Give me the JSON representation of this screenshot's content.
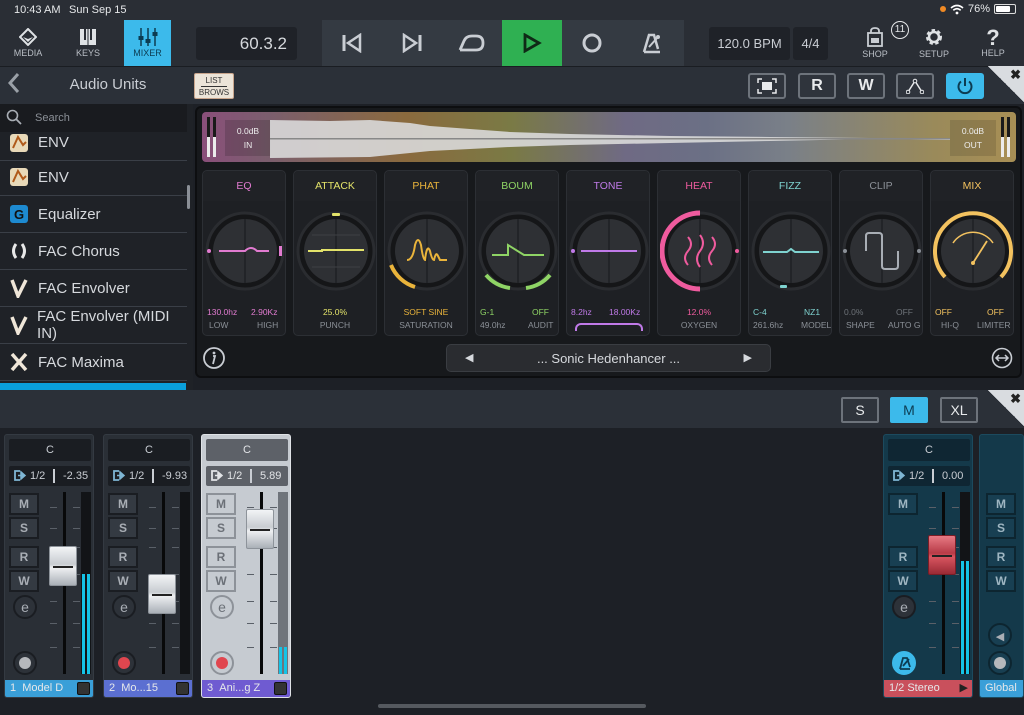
{
  "status": {
    "time": "10:43 AM",
    "date": "Sun Sep 15",
    "battery": "76%",
    "battery_level": 0.76
  },
  "toolbar": {
    "media": "MEDIA",
    "keys": "KEYS",
    "mixer": "MIXER",
    "position": "60.3.2",
    "bpm": "120.0 BPM",
    "signature": "4/4",
    "shop": "SHOP",
    "shop_badge": "11",
    "setup": "SETUP",
    "help": "HELP"
  },
  "browser": {
    "title": "Audio Units",
    "list_brows_line1": "LIST",
    "list_brows_line2": "BROWS",
    "search_placeholder": "Search",
    "items": [
      {
        "label": "ENV",
        "icon": "env-app-icon"
      },
      {
        "label": "ENV",
        "icon": "env-app-icon"
      },
      {
        "label": "Equalizer",
        "icon": "equalizer-app-icon"
      },
      {
        "label": "FAC Chorus",
        "icon": "fac-chorus-icon"
      },
      {
        "label": "FAC Envolver",
        "icon": "fac-envolver-icon"
      },
      {
        "label": "FAC Envolver (MIDI IN)",
        "icon": "fac-envolver-icon"
      },
      {
        "label": "FAC Maxima",
        "icon": "fac-maxima-icon"
      }
    ]
  },
  "plugin_header": {
    "r": "R",
    "w": "W"
  },
  "plugin": {
    "in_level": "0.0dB",
    "in_label": "IN",
    "out_level": "0.0dB",
    "out_label": "OUT",
    "preset": "... Sonic Hedenhancer ...",
    "modules": [
      {
        "title": "EQ",
        "color": "#e17bd0",
        "v1": "130.0hz",
        "v2": "2.90Kz",
        "l1": "LOW",
        "l2": "HIGH"
      },
      {
        "title": "ATTACK",
        "color": "#e3e36a",
        "v1": "25.0%",
        "l1": "PUNCH"
      },
      {
        "title": "PHAT",
        "color": "#eab43b",
        "v1": "SOFT SINE",
        "l1": "SATURATION"
      },
      {
        "title": "BOUM",
        "color": "#8fd465",
        "v1": "G-1",
        "v2": "OFF",
        "l1": "49.0hz",
        "l2": "AUDIT"
      },
      {
        "title": "TONE",
        "color": "#c07ae8",
        "v1": "8.2hz",
        "v2": "18.00Kz"
      },
      {
        "title": "HEAT",
        "color": "#ef5b9e",
        "v1": "12.0%",
        "l1": "OXYGEN"
      },
      {
        "title": "FIZZ",
        "color": "#7fd3d0",
        "v1": "C-4",
        "v2": "NZ1",
        "l1": "261.6hz",
        "l2": "MODEL"
      },
      {
        "title": "CLIP",
        "color": "#8b9097",
        "v1": "0.0%",
        "v2": "OFF",
        "l1": "SHAPE",
        "l2": "AUTO G"
      },
      {
        "title": "MIX",
        "color": "#f3c25f",
        "v1": "OFF",
        "v2": "OFF",
        "l1": "HI-Q",
        "l2": "LIMITER"
      }
    ]
  },
  "mixer_header": {
    "s": "S",
    "m": "M",
    "xl": "XL"
  },
  "mixer": {
    "channels": [
      {
        "pan": "C",
        "route": "1/2",
        "volume": "-2.35",
        "num": "1",
        "name": "Model D",
        "fader": 0.62,
        "meter": 0.55,
        "color": "#3a9fd8",
        "rec_color": "#b5b8bc"
      },
      {
        "pan": "C",
        "route": "1/2",
        "volume": "-9.93",
        "num": "2",
        "name": "Mo...15",
        "fader": 0.42,
        "meter": 0.0,
        "color": "#5b6fd1",
        "rec_color": "#e0464f"
      },
      {
        "pan": "C",
        "route": "1/2",
        "volume": "5.89",
        "num": "3",
        "name": "Ani...g Z",
        "fader": 0.88,
        "meter": 0.15,
        "color": "#6f5bd1",
        "rec_color": "#e0464f"
      }
    ],
    "output": {
      "pan": "C",
      "route": "1/2",
      "volume": "0.00",
      "name": "1/2  Stereo",
      "fader": 0.7,
      "meter": 0.62
    },
    "global": {
      "name": "Global"
    },
    "labels": {
      "m": "M",
      "s": "S",
      "r": "R",
      "w": "W"
    }
  }
}
